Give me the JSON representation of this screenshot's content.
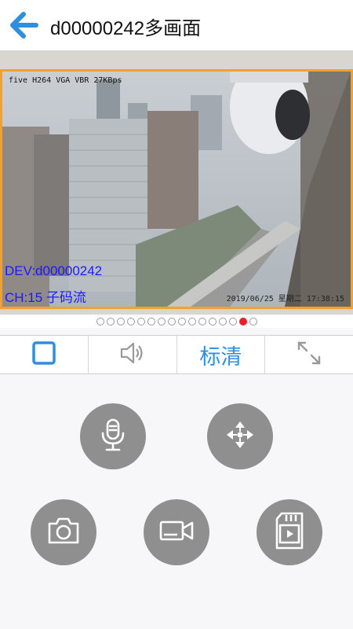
{
  "header": {
    "title": "d00000242多画面",
    "back_icon": "arrow-left-icon"
  },
  "video": {
    "osd_top": "five H264 VGA VBR 27KBps",
    "osd_device": "DEV:d00000242",
    "osd_channel": "CH:15 子码流",
    "osd_timestamp": "2019/06/25 星期二 17:38:15",
    "border_color": "#f2a12c"
  },
  "pager": {
    "total": 16,
    "active_index": 14
  },
  "toolbar": {
    "stop_icon": "stop-square-icon",
    "sound_icon": "speaker-icon",
    "quality_label": "标清",
    "fullscreen_icon": "expand-arrows-icon"
  },
  "controls": {
    "icons": [
      "microphone-icon",
      "ptz-move-icon",
      "camera-icon",
      "record-video-icon",
      "sd-card-playback-icon"
    ]
  },
  "colors": {
    "accent": "#2e8ee0",
    "button_gray": "#8f8f8f",
    "active_dot": "#e8202a",
    "osd_text": "#1a1aff"
  }
}
